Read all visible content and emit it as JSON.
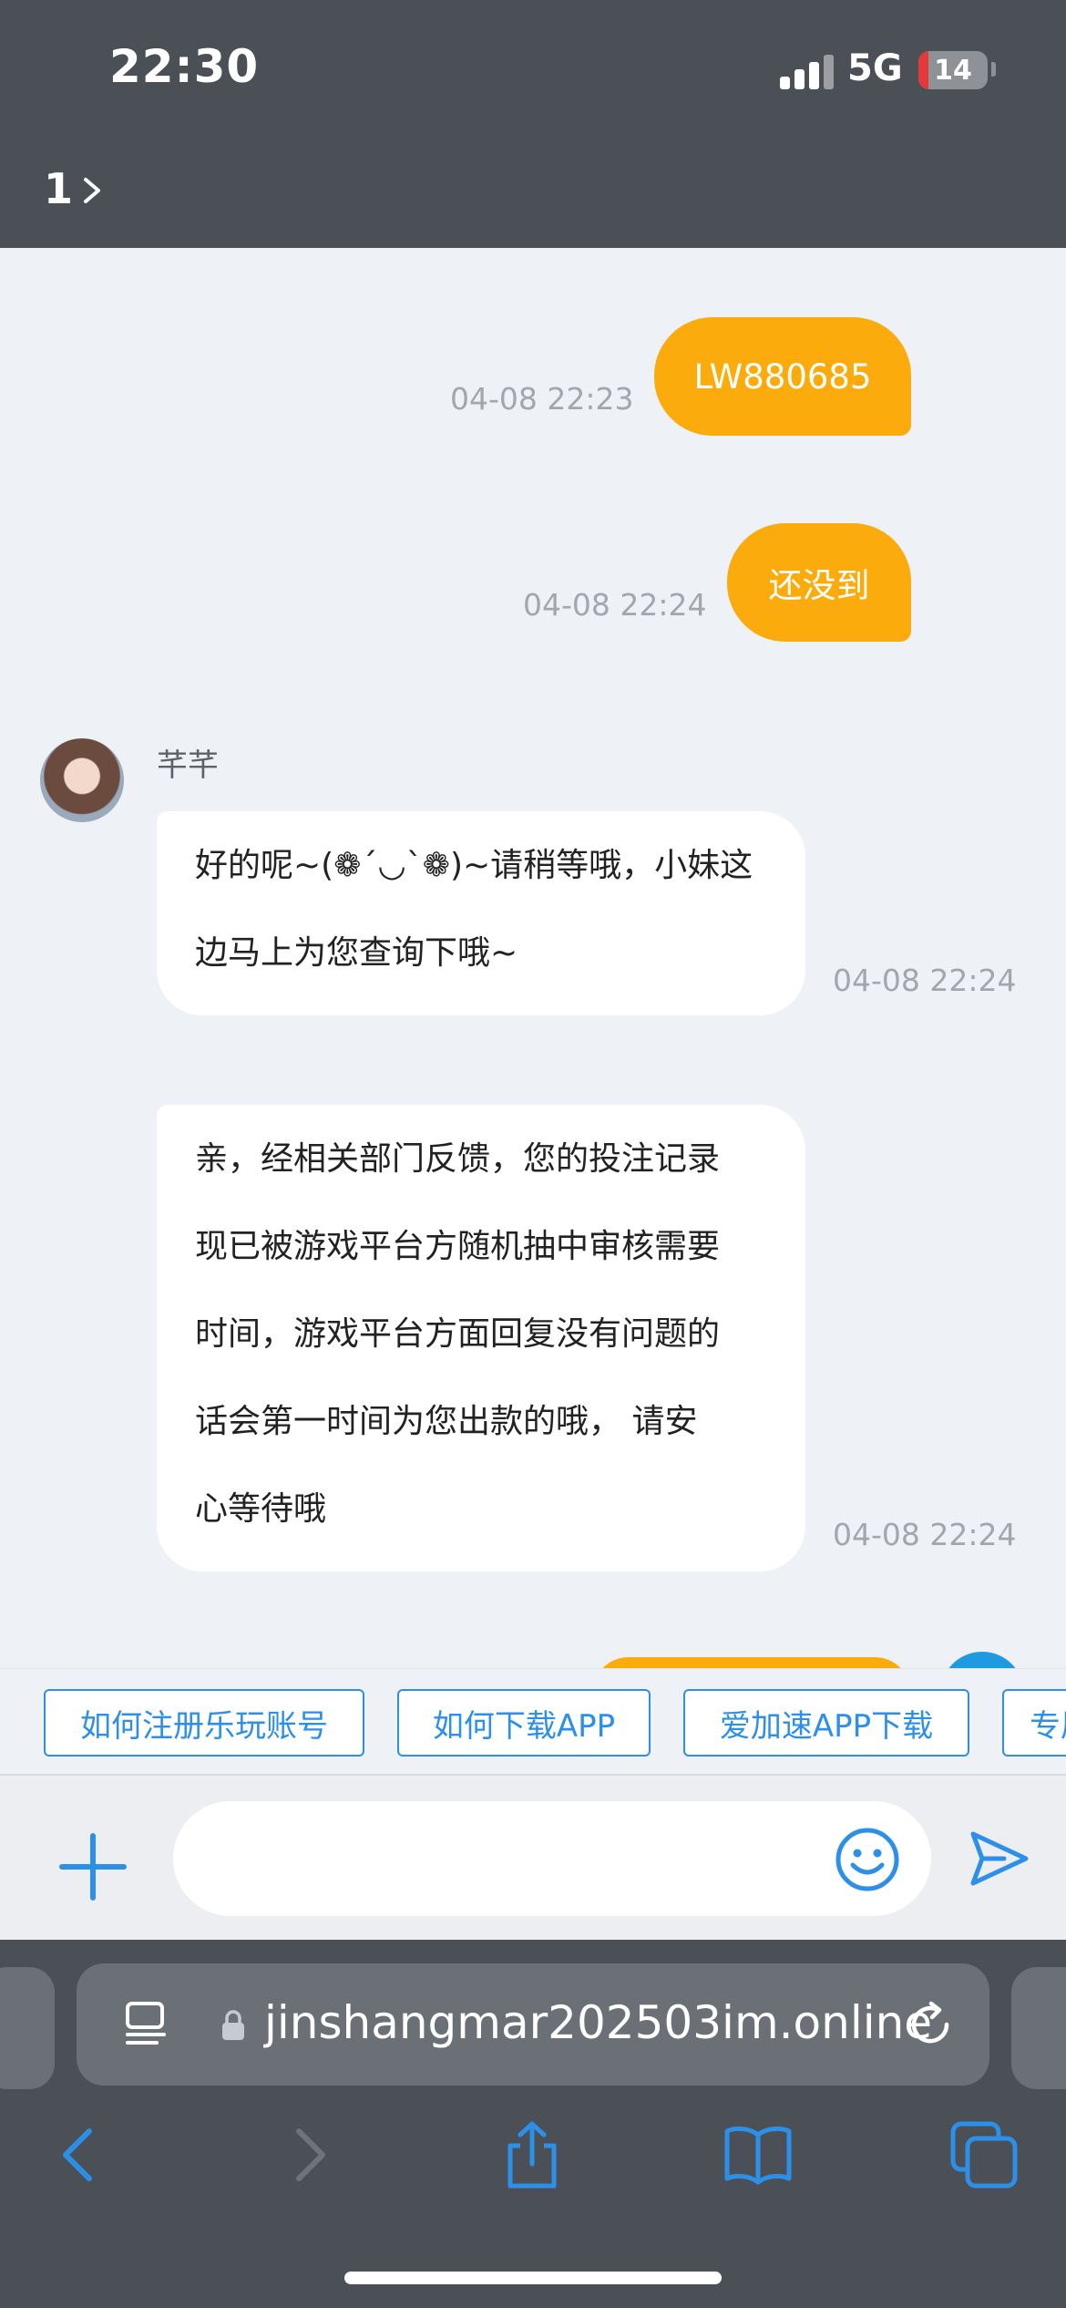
{
  "status_bar": {
    "time": "22:30",
    "network": "5G",
    "battery": "14",
    "battery_level": 0.14
  },
  "header": {
    "title": "1"
  },
  "messages": [
    {
      "direction": "out",
      "text": "LW880685",
      "time": "04-08 22:23"
    },
    {
      "direction": "out",
      "text": "还没到",
      "time": "04-08 22:24"
    },
    {
      "direction": "in",
      "sender": "芊芊",
      "lines": [
        "好的呢~(❁´◡`❁)~请稍等哦，小妹这",
        "边马上为您查询下哦~"
      ],
      "time": "04-08 22:24"
    },
    {
      "direction": "in",
      "lines": [
        "亲，经相关部门反馈，您的投注记录",
        "现已被游戏平台方随机抽中审核需要",
        "时间，游戏平台方面回复没有问题的",
        "话会第一时间为您出款的哦， 请安",
        "心等待哦"
      ],
      "time": "04-08 22:24"
    }
  ],
  "quick_replies": [
    "如何注册乐玩账号",
    "如何下载APP",
    "爱加速APP下载",
    "专属"
  ],
  "input": {
    "value": "",
    "placeholder": ""
  },
  "browser": {
    "url": "jinshangmar202503im.online"
  },
  "colors": {
    "accent": "#fbab0b",
    "link": "#2c8fe8",
    "chrome": "#4b5057"
  },
  "icons": [
    "chevron-right-icon",
    "plus-icon",
    "smile-icon",
    "send-icon",
    "reader-icon",
    "lock-icon",
    "reload-icon",
    "back-icon",
    "forward-icon",
    "share-icon",
    "bookmarks-icon",
    "tabs-icon"
  ]
}
